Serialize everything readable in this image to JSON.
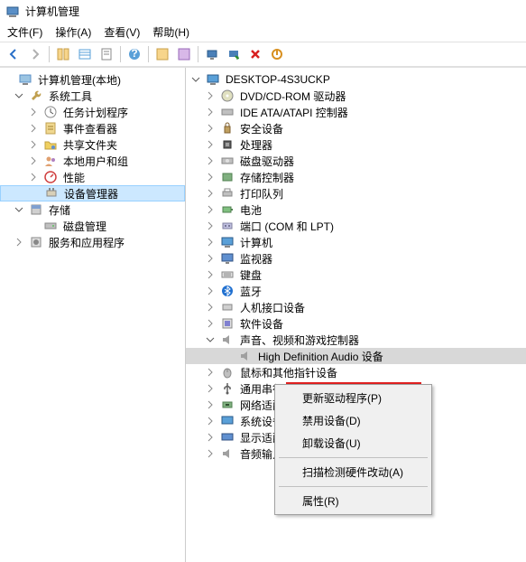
{
  "window": {
    "title": "计算机管理"
  },
  "menu": {
    "file": "文件(F)",
    "action": "操作(A)",
    "view": "查看(V)",
    "help": "帮助(H)"
  },
  "left_tree": {
    "root": "计算机管理(本地)",
    "system_tools": "系统工具",
    "task_scheduler": "任务计划程序",
    "event_viewer": "事件查看器",
    "shared_folders": "共享文件夹",
    "local_users": "本地用户和组",
    "performance": "性能",
    "device_manager": "设备管理器",
    "storage": "存储",
    "disk_mgmt": "磁盘管理",
    "services": "服务和应用程序"
  },
  "right_tree": {
    "root": "DESKTOP-4S3UCKP",
    "dvd": "DVD/CD-ROM 驱动器",
    "ide": "IDE ATA/ATAPI 控制器",
    "security": "安全设备",
    "processors": "处理器",
    "disk_drives": "磁盘驱动器",
    "storage_ctrl": "存储控制器",
    "print_queues": "打印队列",
    "batteries": "电池",
    "ports": "端口 (COM 和 LPT)",
    "computer": "计算机",
    "monitors": "监视器",
    "keyboards": "键盘",
    "bluetooth": "蓝牙",
    "hid": "人机接口设备",
    "software_dev": "软件设备",
    "sound": "声音、视频和游戏控制器",
    "sound_device": "High Definition Audio 设备",
    "mice": "鼠标和其他指针设备",
    "usb": "通用串行总线控制器",
    "network": "网络适配器",
    "system_devices": "系统设备",
    "display": "显示适配器",
    "audio_inputs": "音频输入和输出"
  },
  "context_menu": {
    "update": "更新驱动程序(P)",
    "disable": "禁用设备(D)",
    "uninstall": "卸载设备(U)",
    "scan": "扫描检测硬件改动(A)",
    "properties": "属性(R)"
  }
}
